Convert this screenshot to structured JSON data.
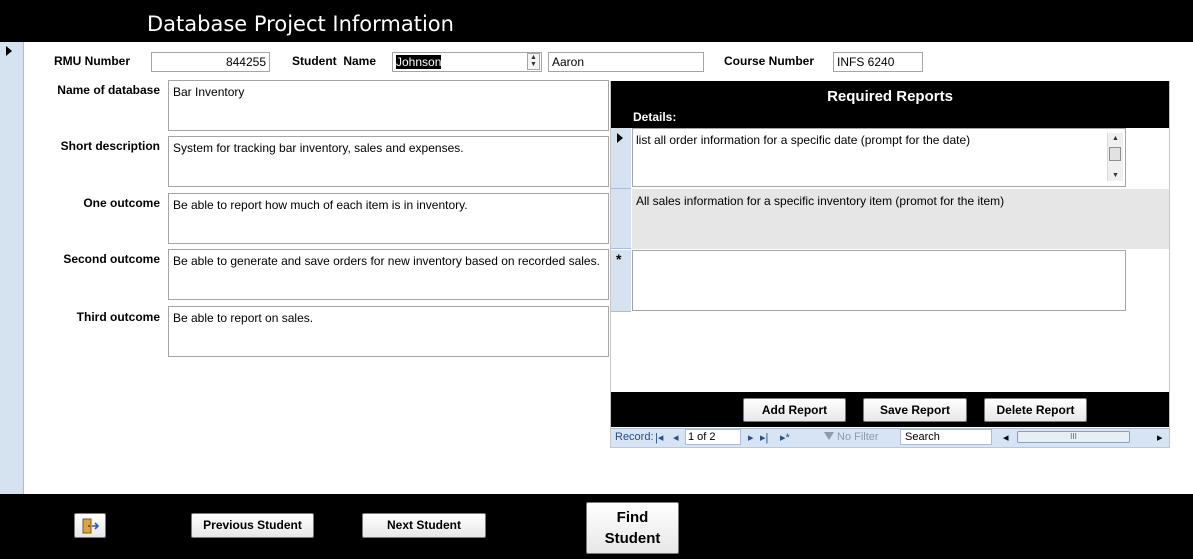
{
  "header": {
    "title": "Database Project Information"
  },
  "form": {
    "rmu_label": "RMU Number",
    "rmu_value": "844255",
    "student_label": "Student",
    "name_label": "Name",
    "last_name": "Johnson",
    "first_name": "Aaron",
    "course_label": "Course Number",
    "course_value": "INFS 6240",
    "fields": [
      {
        "label": "Name of database",
        "value": "Bar Inventory"
      },
      {
        "label": "Short description",
        "value": "System for tracking bar inventory, sales and expenses."
      },
      {
        "label": "One outcome",
        "value": "Be able to report how much of each item is in inventory."
      },
      {
        "label": "Second outcome",
        "value": "Be able to generate and save orders for new inventory based on recorded sales."
      },
      {
        "label": "Third outcome",
        "value": "Be able to report on sales."
      }
    ]
  },
  "subform": {
    "title": "Required Reports",
    "details_label": "Details:",
    "rows": [
      "list all order information for a specific date (prompt for the date)",
      "All sales information for a specific inventory item (promot for the item)"
    ],
    "new_row_marker": "*",
    "buttons": {
      "add": "Add Report",
      "save": "Save Report",
      "delete": "Delete Report"
    },
    "nav": {
      "record_label": "Record:",
      "record_value": "1 of 2",
      "filter": "No Filter",
      "search": "Search",
      "scroll_grip": "III"
    }
  },
  "footer": {
    "prev": "Previous Student",
    "next": "Next Student",
    "find_line1": "Find",
    "find_line2": "Student"
  },
  "icons": {
    "first": "|◂",
    "prev": "◂",
    "next": "▸",
    "last": "▸|",
    "new": "▸*",
    "filter": "funnel-icon",
    "exit": "exit-door-icon"
  }
}
